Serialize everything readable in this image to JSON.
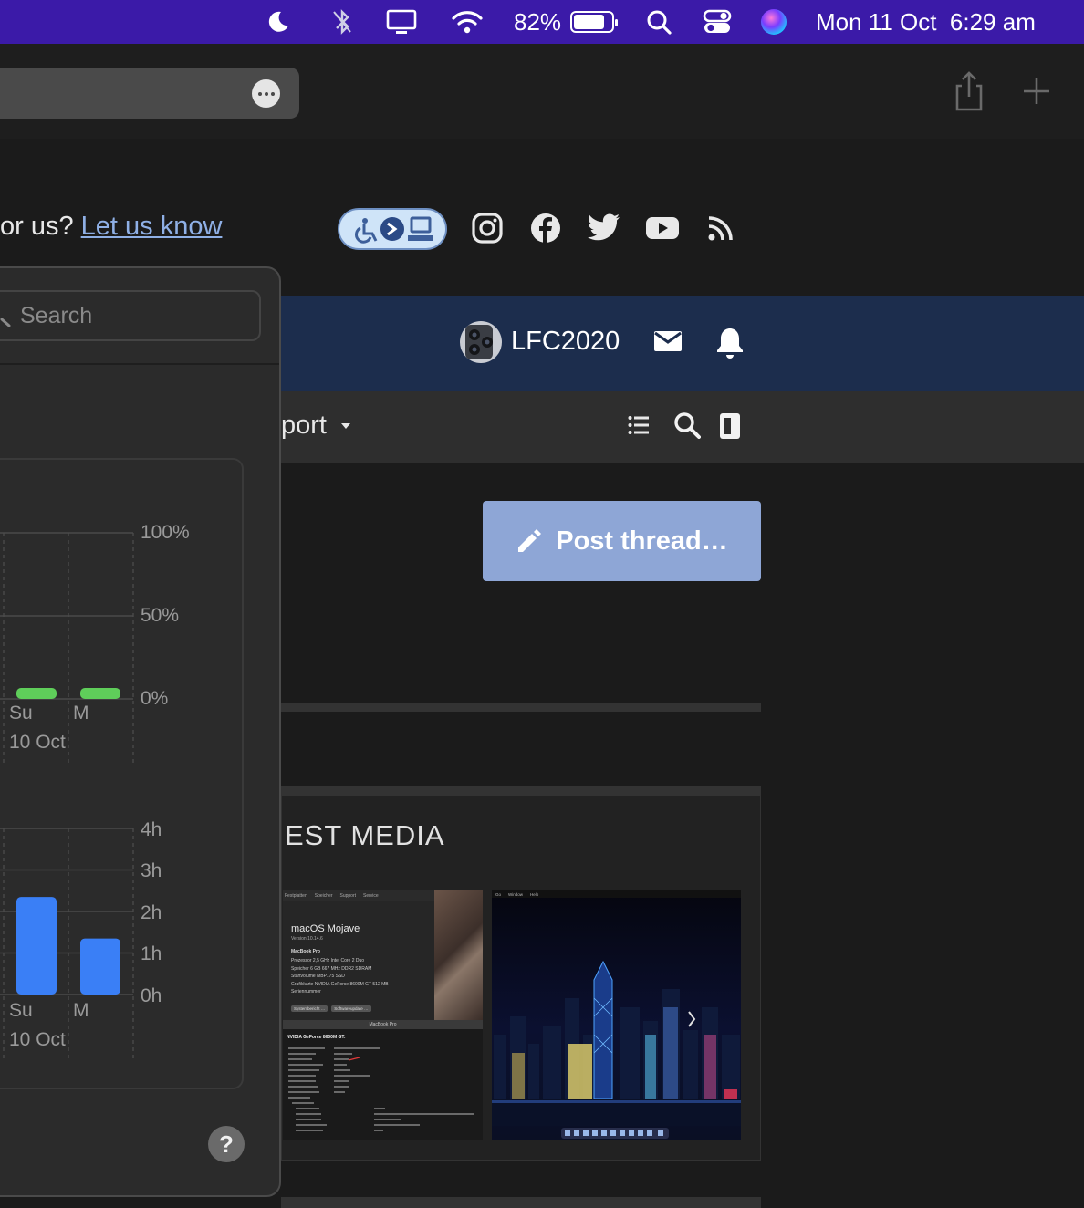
{
  "menubar": {
    "battery_percent": "82%",
    "battery_level": 0.82,
    "datetime": "Mon 11 Oct  6:29 am",
    "icons": [
      "moon-icon",
      "bluetooth-icon",
      "display-icon",
      "wifi-icon",
      "battery-icon",
      "spotlight-search-icon",
      "control-center-icon",
      "siri-icon"
    ]
  },
  "browser": {
    "icons": [
      "more-options-icon",
      "share-icon",
      "new-tab-icon"
    ]
  },
  "header": {
    "contact_prefix": "or us?",
    "contact_link": "Let us know",
    "social_icons": [
      "accessibility-badge-icon",
      "instagram-icon",
      "facebook-icon",
      "twitter-icon",
      "youtube-icon",
      "rss-icon"
    ]
  },
  "userbar": {
    "username": "LFC2020",
    "icons": [
      "mail-icon",
      "bell-icon"
    ]
  },
  "nav": {
    "label": "port",
    "icons": [
      "list-icon",
      "search-icon",
      "sidebar-toggle-icon"
    ]
  },
  "post_button": {
    "label": "Post thread…"
  },
  "media": {
    "title": "EST MEDIA",
    "thumb1": {
      "tabs": [
        "Festplatten",
        "Speicher",
        "Support",
        "Service"
      ],
      "os_name": "macOS Mojave",
      "version": "Version 10.14.6",
      "model": "MacBook Pro",
      "specs": [
        "Prozessor  2,5 GHz Intel Core 2 Duo",
        "Speicher  6 GB 667 MHz DDR2 SDRAM",
        "Startvolume  MBP175 SSD",
        "Grafikkarte  NVIDIA GeForce 8600M GT 512 MB",
        "Seriennummer"
      ],
      "buttons": [
        "Systembericht …",
        "Softwareupdate …"
      ],
      "footer": "MacBook Pro",
      "gpu_heading": "NVIDIA GeForce 8600M GT:"
    },
    "thumb2": {
      "menu": [
        "Go",
        "Window",
        "Help"
      ]
    }
  },
  "screen_time": {
    "search_placeholder": "Search",
    "pickups_chart": {
      "y_ticks": [
        "100%",
        "50%",
        "0%"
      ],
      "x_days": [
        "Su",
        "M"
      ],
      "date": "10 Oct",
      "values_percent": [
        3,
        3
      ],
      "bar_color": "#5fce5a"
    },
    "usage_chart": {
      "y_ticks": [
        "4h",
        "3h",
        "2h",
        "1h",
        "0h"
      ],
      "x_days": [
        "Su",
        "M"
      ],
      "date": "10 Oct",
      "values_hours": [
        2.35,
        1.35
      ],
      "bar_color": "#3a7ff6"
    },
    "help_label": "?"
  },
  "chart_data": [
    {
      "type": "bar",
      "categories": [
        "Su",
        "M"
      ],
      "values": [
        3,
        3
      ],
      "ylim": [
        0,
        100
      ],
      "ytick_labels": [
        "100%",
        "50%",
        "0%"
      ],
      "xlabel": "10 Oct"
    },
    {
      "type": "bar",
      "categories": [
        "Su",
        "M"
      ],
      "values": [
        2.35,
        1.35
      ],
      "ylim": [
        0,
        4
      ],
      "ytick_labels": [
        "4h",
        "3h",
        "2h",
        "1h",
        "0h"
      ],
      "xlabel": "10 Oct"
    }
  ]
}
